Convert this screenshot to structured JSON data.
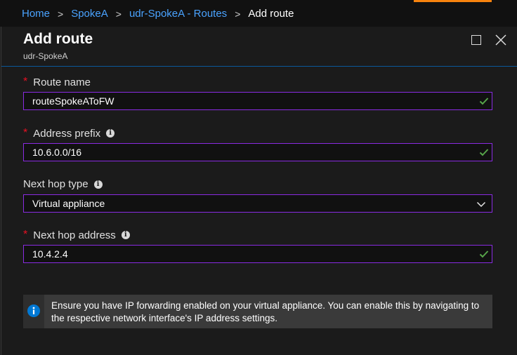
{
  "breadcrumb": {
    "items": [
      "Home",
      "SpokeA",
      "udr-SpokeA - Routes"
    ],
    "current": "Add route",
    "separator": ">"
  },
  "blade": {
    "title": "Add route",
    "subtitle": "udr-SpokeA"
  },
  "form": {
    "route_name": {
      "label": "Route name",
      "value": "routeSpokeAToFW",
      "required": true,
      "valid": true
    },
    "address_prefix": {
      "label": "Address prefix",
      "value": "10.6.0.0/16",
      "required": true,
      "valid": true
    },
    "next_hop_type": {
      "label": "Next hop type",
      "value": "Virtual appliance"
    },
    "next_hop_address": {
      "label": "Next hop address",
      "value": "10.4.2.4",
      "required": true,
      "valid": true
    }
  },
  "info": {
    "text": "Ensure you have IP forwarding enabled on your virtual appliance. You can enable this by navigating to the respective network interface's IP address settings."
  },
  "icons": {
    "info": "info-icon",
    "check": "checkmark-icon",
    "chevron": "chevron-down-icon",
    "maximize": "maximize-icon",
    "close": "close-icon"
  },
  "colors": {
    "accent": "#f7830e",
    "link": "#4aa3ff",
    "input_border": "#8a2be2",
    "valid": "#57a64a",
    "required": "#e81123",
    "info_blue": "#0078d4"
  }
}
